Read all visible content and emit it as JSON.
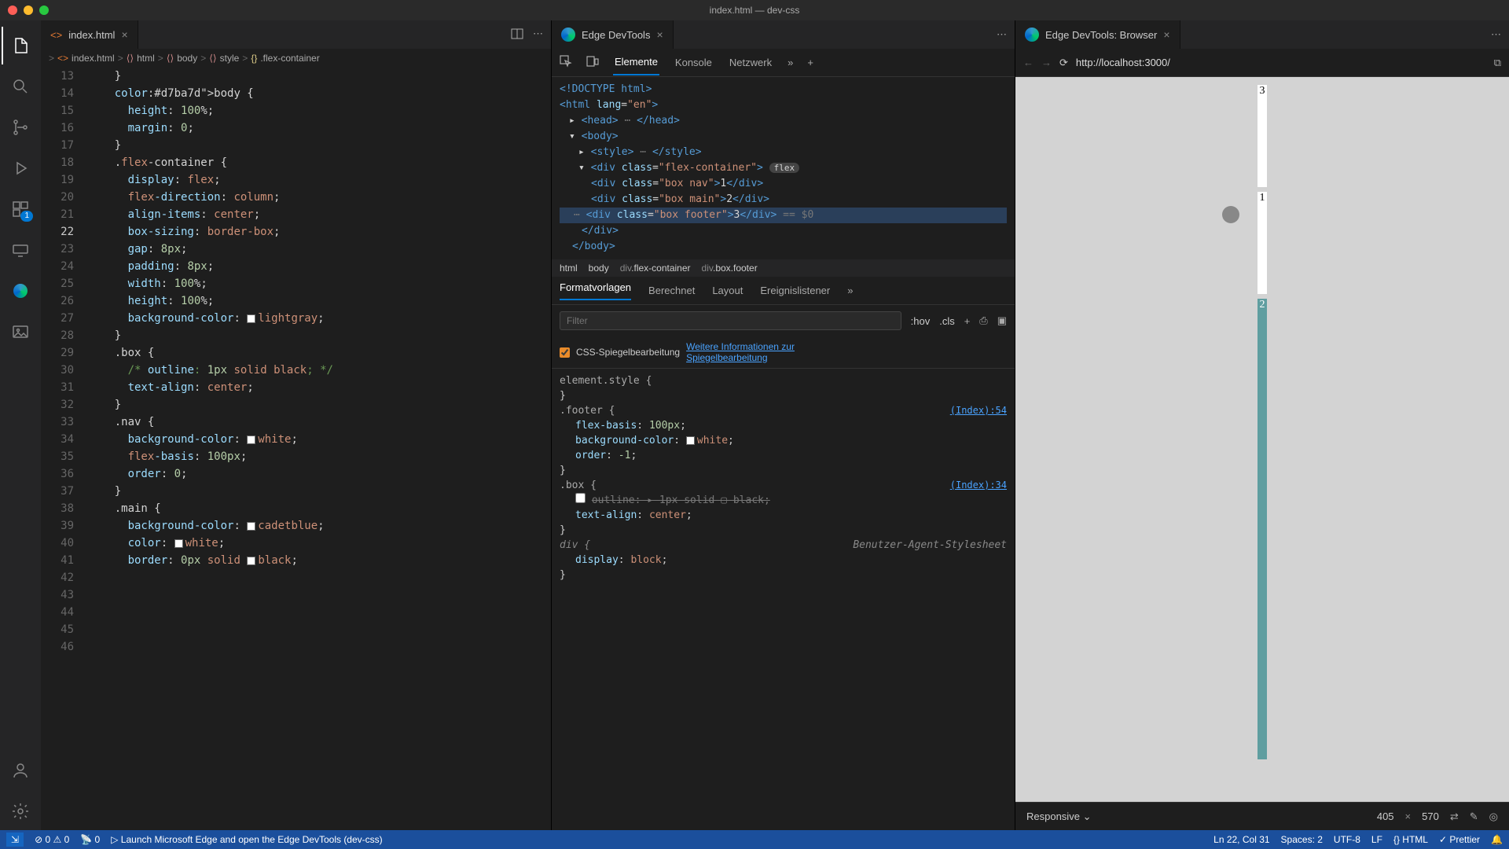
{
  "titlebar": {
    "title": "index.html — dev-css"
  },
  "activitybar": {
    "badge": "1"
  },
  "editor": {
    "tab": {
      "filename": "index.html"
    },
    "breadcrumbs": [
      "index.html",
      "html",
      "body",
      "style",
      ".flex-container"
    ],
    "linestart": 13,
    "cursorline": 22,
    "lines": [
      "    }",
      "",
      "    body {",
      "      height: 100%;",
      "      margin: 0;",
      "    }",
      "",
      "    .flex-container {",
      "      display: flex;",
      "      flex-direction: column;",
      "      align-items: center;",
      "      box-sizing: border-box;",
      "      gap: 8px;",
      "      padding: 8px;",
      "      width: 100%;",
      "      height: 100%;",
      "      background-color: ▢lightgray;",
      "    }",
      "",
      "    .box {",
      "      /* outline: 1px solid black; */",
      "      text-align: center;",
      "    }",
      "",
      "    .nav {",
      "      background-color: ▢white;",
      "      flex-basis: 100px;",
      "      order: 0;",
      "    }",
      "",
      "    .main {",
      "      background-color: ▢cadetblue;",
      "      color: ▢white;",
      "      border: 0px solid ▢black;"
    ]
  },
  "devtools": {
    "tab_title": "Edge DevTools",
    "toolbar": {
      "tabs": [
        "Elemente",
        "Konsole",
        "Netzwerk"
      ]
    },
    "dom_crumbs": [
      "html",
      "body",
      "div.flex-container",
      "div.box.footer"
    ],
    "style_tabs": [
      "Formatvorlagen",
      "Berechnet",
      "Layout",
      "Ereignislistener"
    ],
    "filter_placeholder": "Filter",
    "hov": ":hov",
    "cls": ".cls",
    "mirror_label": "CSS-Spiegelbearbeitung",
    "mirror_link": "Weitere Informationen zur Spiegelbearbeitung",
    "rules": {
      "element_style": "element.style {",
      "footer_sel": ".footer {",
      "footer_src": "(Index):54",
      "footer_props": [
        "flex-basis: 100px;",
        "background-color: ▢white;",
        "order: -1;"
      ],
      "box_sel": ".box {",
      "box_src": "(Index):34",
      "box_outline": "outline: ▸ 1px solid ▢ black;",
      "box_align": "text-align: center;",
      "div_sel": "div {",
      "ua": "Benutzer-Agent-Stylesheet",
      "div_display": "display: block;"
    }
  },
  "browser": {
    "tab_title": "Edge DevTools: Browser",
    "url": "http://localhost:3000/",
    "boxes": {
      "b3": "3",
      "b1": "1",
      "b2": "2"
    },
    "responsive": {
      "label": "Responsive",
      "w": "405",
      "h": "570"
    }
  },
  "statusbar": {
    "errors": "0",
    "warnings": "0",
    "port": "0",
    "launch": "Launch Microsoft Edge and open the Edge DevTools (dev-css)",
    "cursor": "Ln 22, Col 31",
    "spaces": "Spaces: 2",
    "enc": "UTF-8",
    "eol": "LF",
    "lang": "HTML",
    "prettier": "Prettier"
  }
}
